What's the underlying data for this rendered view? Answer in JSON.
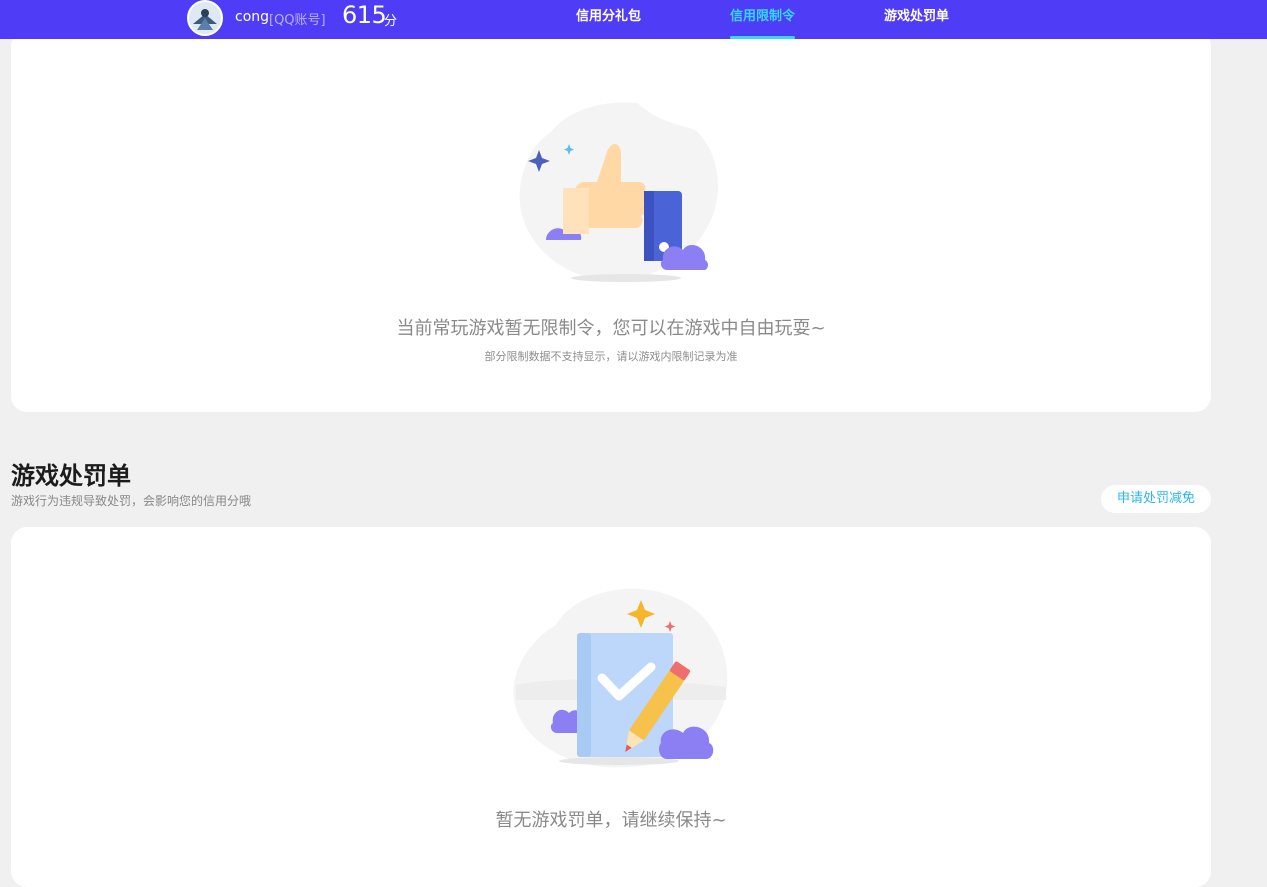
{
  "header": {
    "user_name": "cong",
    "account_type": "[QQ账号]",
    "score": "615",
    "score_unit": "分",
    "tabs": [
      {
        "label": "信用分礼包",
        "active": false
      },
      {
        "label": "信用限制令",
        "active": true
      },
      {
        "label": "游戏处罚单",
        "active": false
      }
    ],
    "bar_color": "#4f3cf7",
    "active_color": "#35d7ff"
  },
  "restriction_card": {
    "icon": "thumbs-up-illustration",
    "message": "当前常玩游戏暂无限制令，您可以在游戏中自由玩耍~",
    "note": "部分限制数据不支持显示，请以游戏内限制记录为准"
  },
  "penalty_section": {
    "title": "游戏处罚单",
    "description": "游戏行为违规导致处罚，会影响您的信用分哦",
    "appeal_button": "申请处罚减免",
    "card": {
      "icon": "document-pencil-illustration",
      "message": "暂无游戏罚单，请继续保持~"
    }
  }
}
